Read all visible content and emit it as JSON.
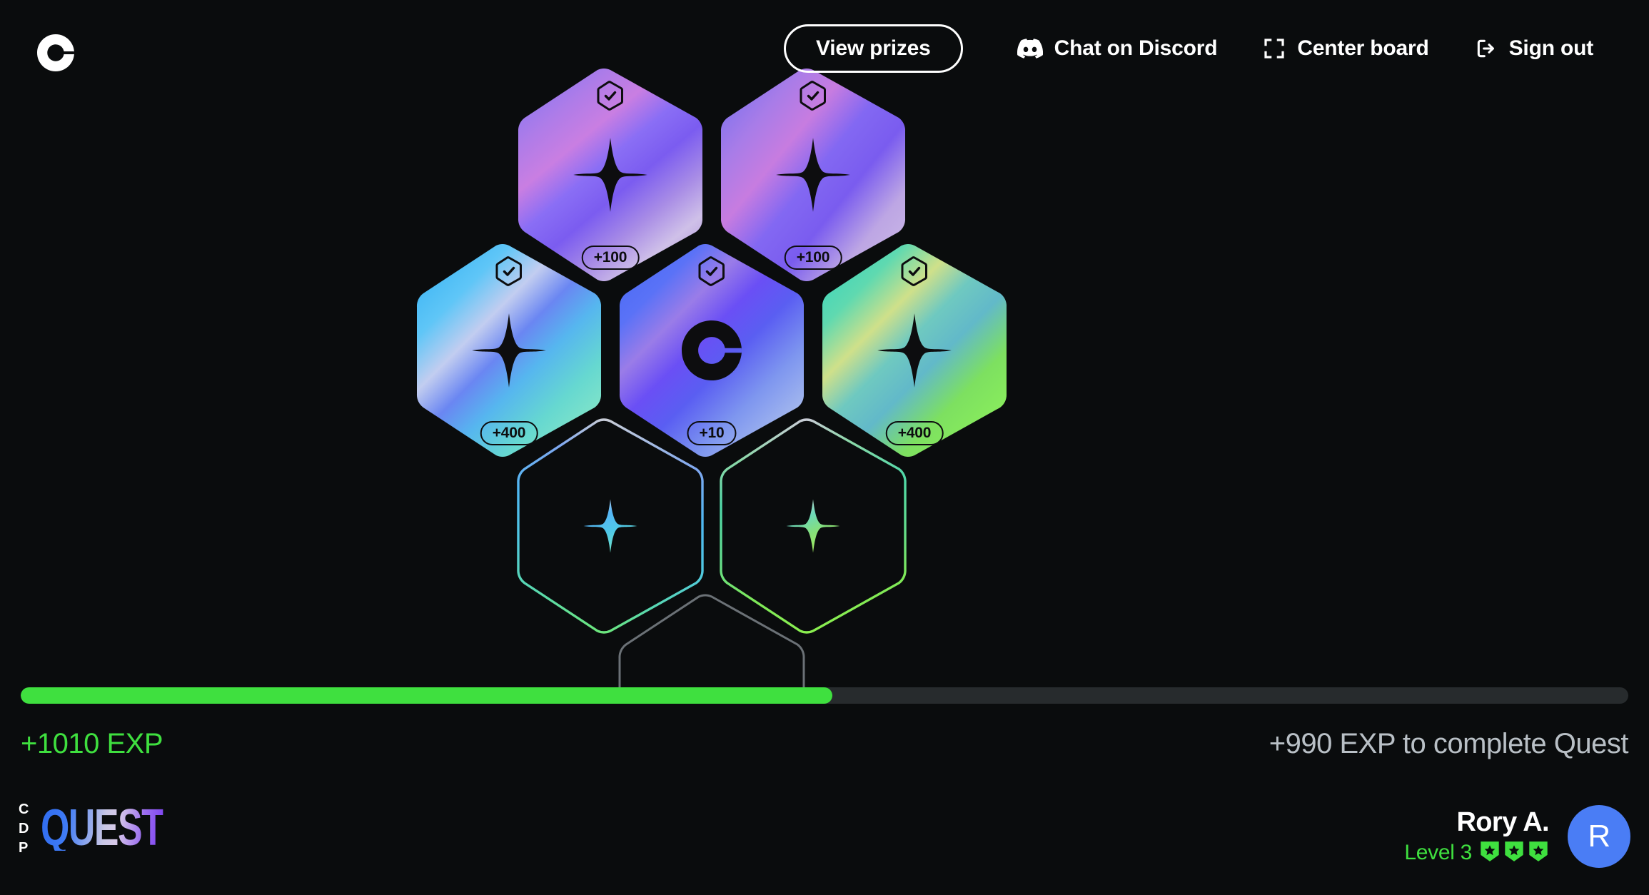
{
  "app": {
    "title": "CDP Quest",
    "background_color": "#0a0c0d",
    "accent_green": "#3fe03f",
    "accent_blue": "#4a7df5"
  },
  "header": {
    "logo_name": "coinbase-logo",
    "view_prizes_label": "View prizes",
    "nav": [
      {
        "id": "discord",
        "label": "Chat on Discord",
        "icon": "discord-icon"
      },
      {
        "id": "center-board",
        "label": "Center board",
        "icon": "crosshair-frame-icon"
      },
      {
        "id": "sign-out",
        "label": "Sign out",
        "icon": "sign-out-icon"
      }
    ]
  },
  "board": {
    "tiles": [
      {
        "id": "tile-1",
        "state": "completed",
        "reward": "+100",
        "glyph": "sparkle-star-icon",
        "badge": "check-badge-icon",
        "palette": "purple"
      },
      {
        "id": "tile-2",
        "state": "completed",
        "reward": "+100",
        "glyph": "sparkle-star-icon",
        "badge": "check-badge-icon",
        "palette": "purple"
      },
      {
        "id": "tile-3",
        "state": "completed",
        "reward": "+400",
        "glyph": "sparkle-star-icon",
        "badge": "check-badge-icon",
        "palette": "blue"
      },
      {
        "id": "tile-4",
        "state": "completed",
        "reward": "+10",
        "glyph": "coinbase-logo-icon",
        "badge": "check-badge-icon",
        "palette": "indigo"
      },
      {
        "id": "tile-5",
        "state": "completed",
        "reward": "+400",
        "glyph": "sparkle-star-icon",
        "badge": "check-badge-icon",
        "palette": "green"
      },
      {
        "id": "tile-6",
        "state": "locked",
        "reward": "",
        "glyph": "sparkle-star-icon",
        "badge": "",
        "palette": "outline-blue"
      },
      {
        "id": "tile-7",
        "state": "locked",
        "reward": "",
        "glyph": "sparkle-star-icon",
        "badge": "",
        "palette": "outline-green"
      },
      {
        "id": "tile-8",
        "state": "hidden",
        "reward": "",
        "glyph": "",
        "badge": "",
        "palette": "outline-gray"
      }
    ]
  },
  "progress": {
    "percent": 50.5,
    "earned_label": "+1010 EXP",
    "remaining_label": "+990 EXP to complete Quest",
    "fill_color": "#3fe03f",
    "track_color": "#272b2d"
  },
  "footer": {
    "brand_prefix": [
      "C",
      "D",
      "P"
    ],
    "brand_word": "QUEST",
    "user": {
      "name": "Rory A.",
      "level_label": "Level 3",
      "level_badge_count": 3,
      "avatar_initial": "R"
    }
  }
}
